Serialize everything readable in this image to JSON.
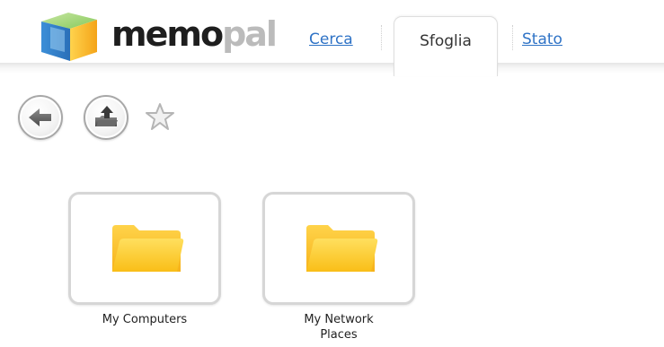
{
  "header": {
    "logo": {
      "word_dark": "memo",
      "word_light": "pal"
    },
    "tabs": [
      {
        "label": "Cerca",
        "active": false
      },
      {
        "label": "Sfoglia",
        "active": true
      },
      {
        "label": "Stato",
        "active": false
      }
    ]
  },
  "toolbar": {
    "back_icon": "back-arrow-icon",
    "up_icon": "up-folder-icon",
    "favorite_icon": "star-icon"
  },
  "items": [
    {
      "label_line1": "My Computers",
      "label_line2": "",
      "icon": "folder-icon"
    },
    {
      "label_line1": "My Network",
      "label_line2": "Places",
      "icon": "folder-icon"
    }
  ],
  "colors": {
    "link": "#2f73c6",
    "folder": "#ffc81e",
    "button_border": "#a8a8a8",
    "tile_border": "#d6d6d6"
  }
}
